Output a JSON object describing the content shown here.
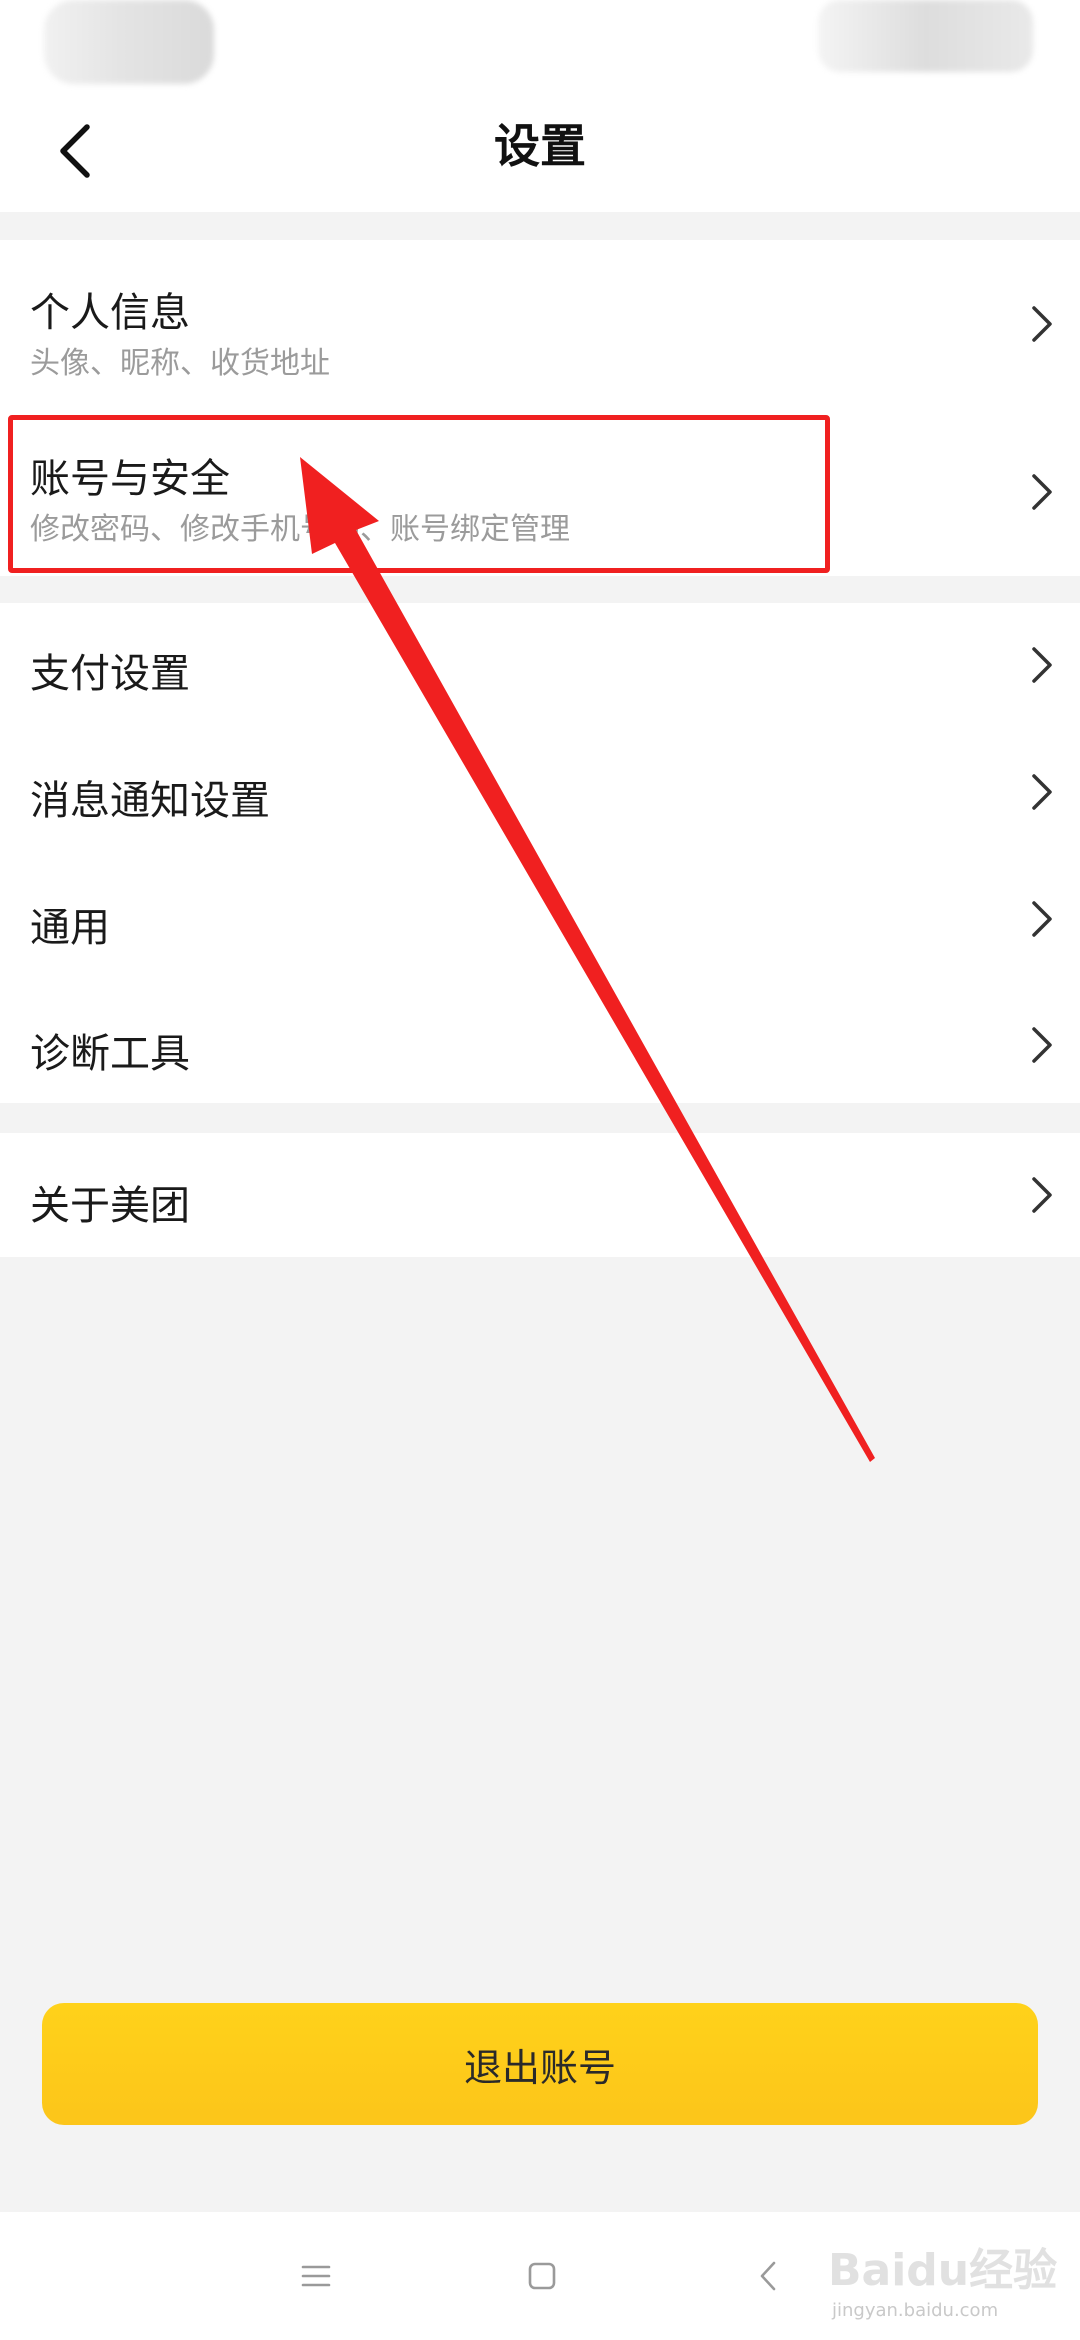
{
  "header": {
    "title": "设置",
    "back_icon": "chevron-left-icon"
  },
  "settings": {
    "personal_info": {
      "title": "个人信息",
      "subtitle": "头像、昵称、收货地址"
    },
    "account_security": {
      "title": "账号与安全",
      "subtitle": "修改密码、修改手机号码、账号绑定管理"
    },
    "payment": {
      "title": "支付设置"
    },
    "notifications": {
      "title": "消息通知设置"
    },
    "general": {
      "title": "通用"
    },
    "diagnostics": {
      "title": "诊断工具"
    },
    "about": {
      "title": "关于美团"
    },
    "chevron_icon": "chevron-right-icon"
  },
  "logout": {
    "label": "退出账号"
  },
  "annotation": {
    "highlight_color": "#f02020",
    "target": "账号与安全"
  },
  "system_nav": {
    "menu_icon": "menu-icon",
    "home_icon": "square-icon",
    "back_icon": "back-triangle-icon"
  },
  "watermark": {
    "text": "Baidu经验",
    "url": "jingyan.baidu.com"
  },
  "colors": {
    "accent": "#fcc51a",
    "background": "#f3f3f3",
    "subtitle": "#9b9b9b"
  }
}
